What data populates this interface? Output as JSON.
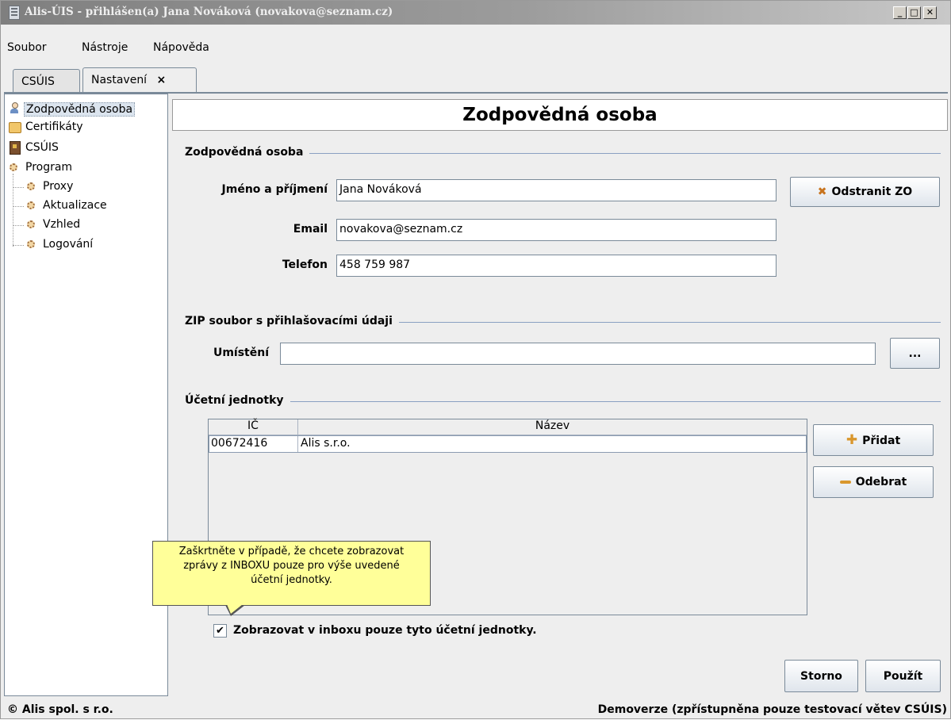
{
  "window": {
    "title": "Alis-ÚIS - přihlášen(a) Jana Nováková (novakova@seznam.cz)",
    "controls": {
      "minimize": "_",
      "maximize": "□",
      "close": "✕"
    }
  },
  "menu": {
    "items": [
      "Soubor",
      "Nástroje",
      "Nápověda"
    ]
  },
  "tabs": [
    {
      "label": "CSÚIS"
    },
    {
      "label": "Nastavení",
      "close": "×"
    }
  ],
  "sidebar": {
    "items": [
      {
        "label": "Zodpovědná osoba",
        "icon": "person-icon",
        "selected": true
      },
      {
        "label": "Certifikáty",
        "icon": "certificate-icon"
      },
      {
        "label": "CSÚIS",
        "icon": "book-icon"
      },
      {
        "label": "Program",
        "icon": "gear-icon"
      },
      {
        "label": "Proxy",
        "icon": "gear-icon"
      },
      {
        "label": "Aktualizace",
        "icon": "gear-icon"
      },
      {
        "label": "Vzhled",
        "icon": "gear-icon"
      },
      {
        "label": "Logování",
        "icon": "gear-icon"
      }
    ]
  },
  "main": {
    "title": "Zodpovědná osoba",
    "section_person": {
      "title": "Zodpovědná osoba",
      "name_label": "Jméno a příjmení",
      "name_value": "Jana Nováková",
      "email_label": "Email",
      "email_value": "novakova@seznam.cz",
      "phone_label": "Telefon",
      "phone_value": "458 759 987",
      "remove_button": "Odstranit ZO"
    },
    "section_zip": {
      "title": "ZIP soubor s přihlašovacími údaji",
      "location_label": "Umístění",
      "location_value": "",
      "browse_button": "..."
    },
    "section_units": {
      "title": "Účetní jednotky",
      "columns": [
        "IČ",
        "Název"
      ],
      "rows": [
        {
          "ic": "00672416",
          "name": "Alis s.r.o."
        }
      ],
      "add_button": "Přidat",
      "remove_button": "Odebrat",
      "tooltip_lines": [
        "Zaškrtněte v případě, že chcete zobrazovat",
        "zprávy z INBOXU pouze pro výše uvedené",
        "účetní jednotky."
      ],
      "checkbox_label": "Zobrazovat v inboxu pouze tyto účetní jednotky.",
      "checkbox_mark": "✔",
      "checkbox_checked": true
    },
    "cancel_button": "Storno",
    "apply_button": "Použít"
  },
  "status": {
    "left": "© Alis spol. s r.o.",
    "right": "Demoverze (zpřístupněna pouze testovací větev CSÚIS)"
  }
}
